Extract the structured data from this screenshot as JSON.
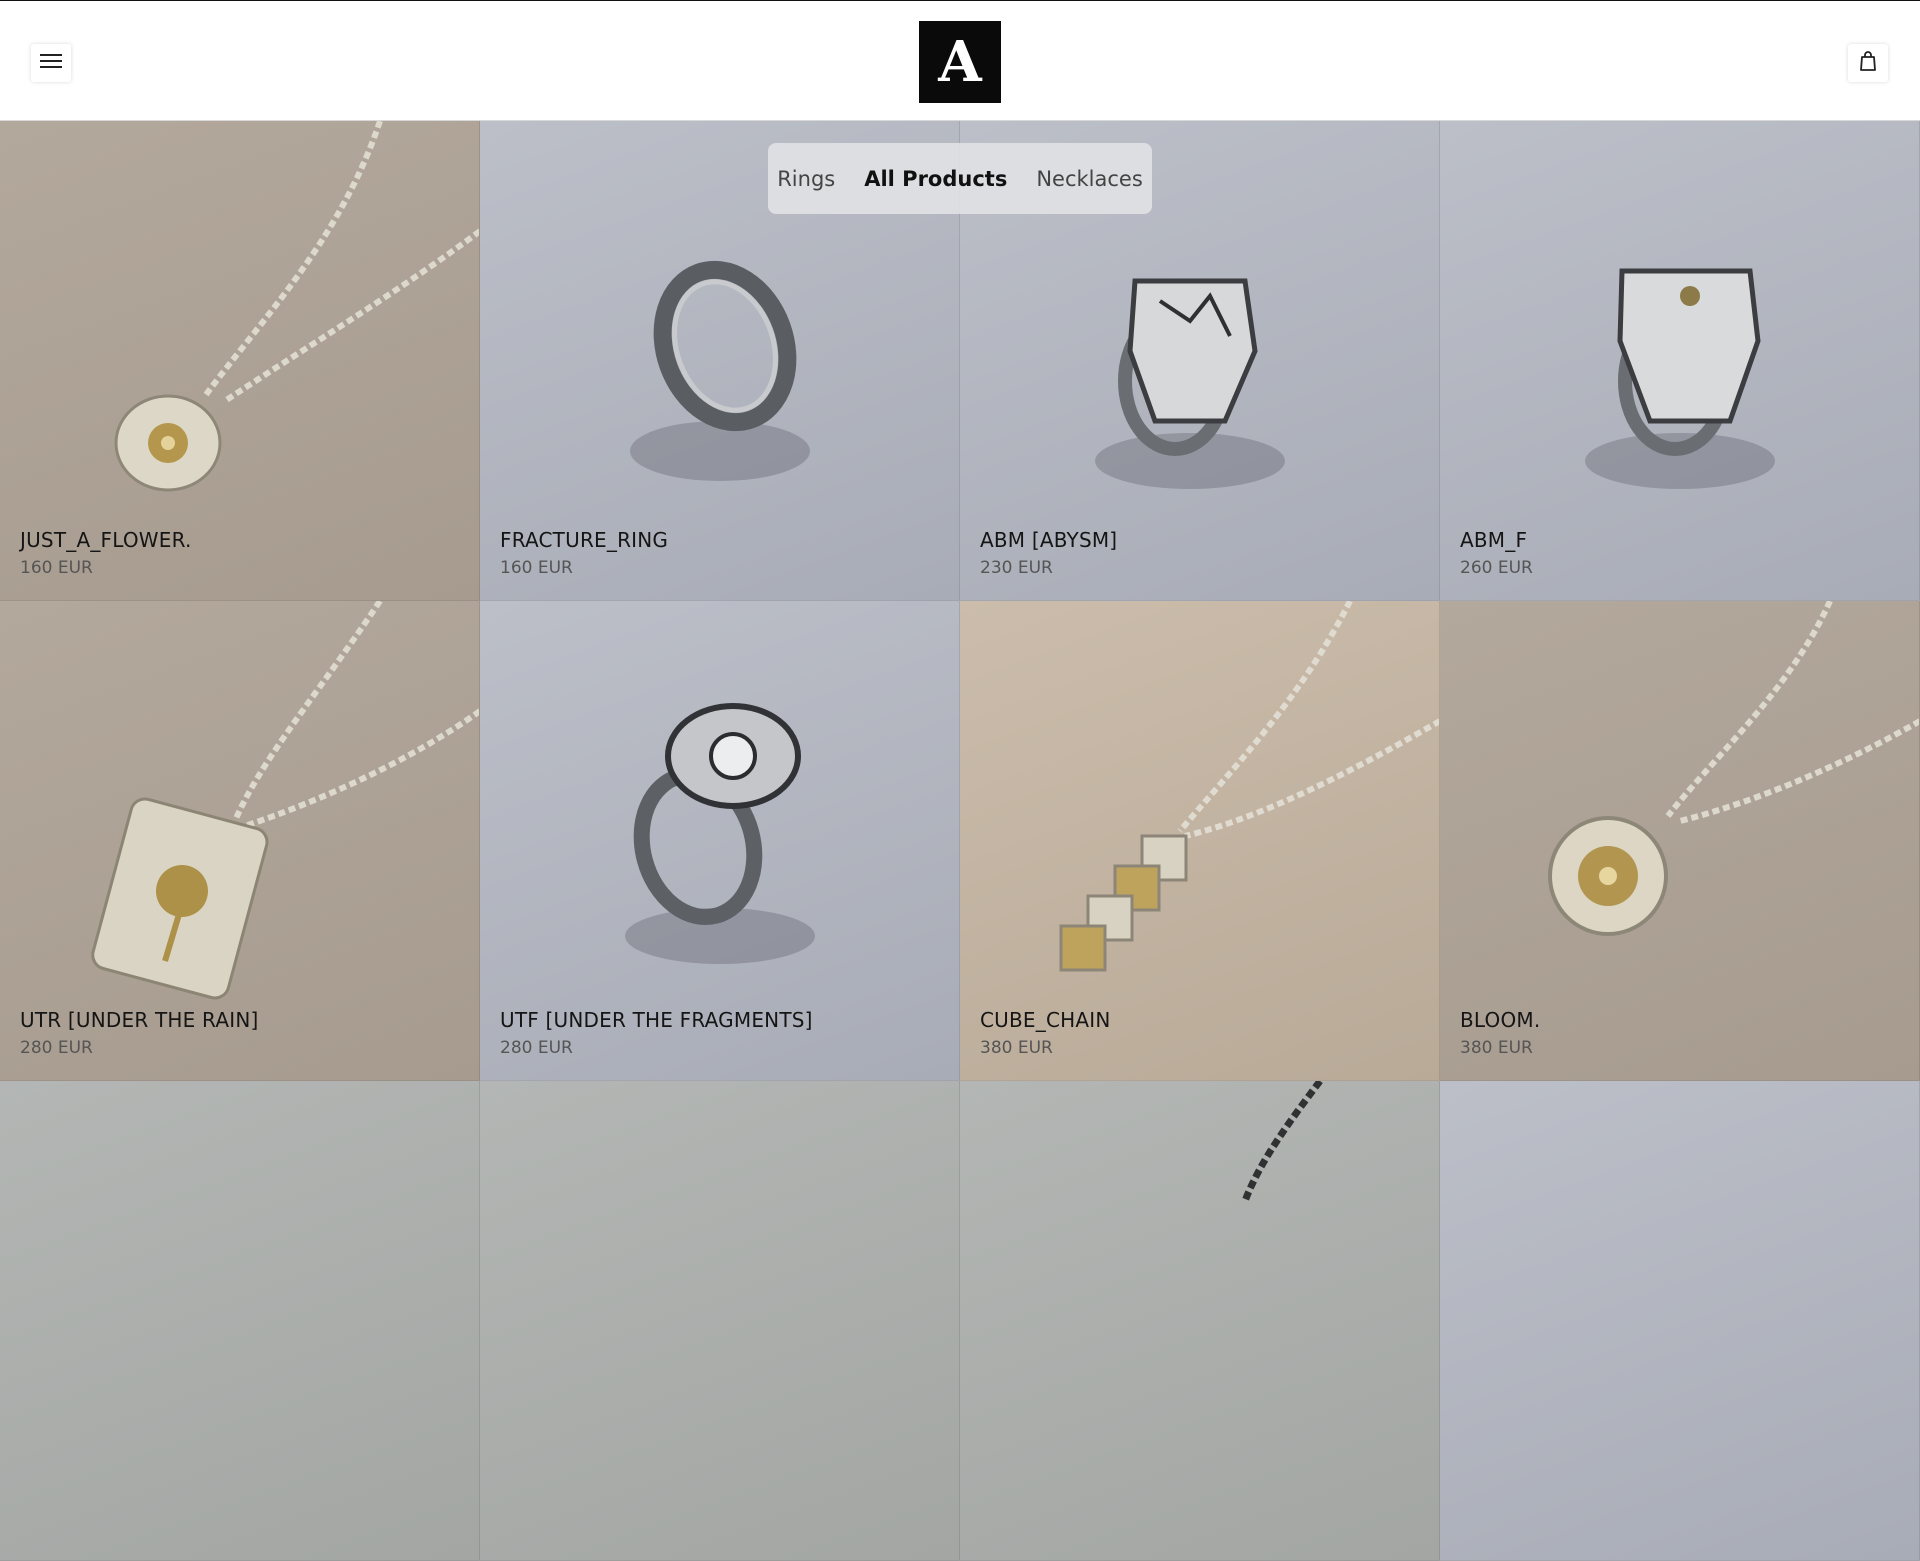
{
  "header": {
    "logo_letter": "A",
    "menu_icon": "hamburger-menu-icon",
    "cart_icon": "shopping-bag-icon"
  },
  "filters": [
    {
      "label": "Rings",
      "active": false
    },
    {
      "label": "All Products",
      "active": true
    },
    {
      "label": "Necklaces",
      "active": false
    }
  ],
  "products": [
    {
      "name": "JUST_A_FLOWER.",
      "price": "160 EUR",
      "type": "necklace-round"
    },
    {
      "name": "FRACTURE_RING",
      "price": "160 EUR",
      "type": "ring-band"
    },
    {
      "name": "ABM [ABYSM]",
      "price": "230 EUR",
      "type": "ring-signet"
    },
    {
      "name": "ABM_F",
      "price": "260 EUR",
      "type": "ring-signet-flower"
    },
    {
      "name": "UTR [UNDER THE RAIN]",
      "price": "280 EUR",
      "type": "necklace-tag"
    },
    {
      "name": "UTF [UNDER THE FRAGMENTS]",
      "price": "280 EUR",
      "type": "ring-flower"
    },
    {
      "name": "CUBE_CHAIN",
      "price": "380 EUR",
      "type": "necklace-cubes"
    },
    {
      "name": "BLOOM.",
      "price": "380 EUR",
      "type": "necklace-round"
    }
  ],
  "colors": {
    "logo_bg": "#0a0a0a",
    "silver": "#c9cbcc",
    "gold": "#a88f4a"
  }
}
